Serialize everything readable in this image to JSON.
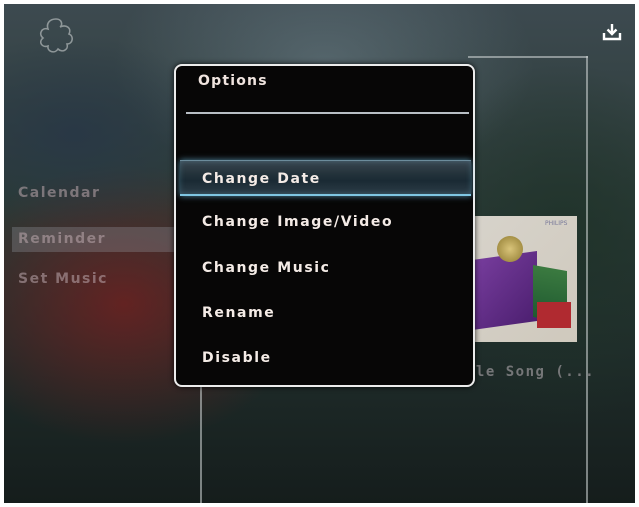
{
  "dialog": {
    "title": "Options",
    "items": [
      {
        "label": "Change Date",
        "selected": true
      },
      {
        "label": "Change Image/Video",
        "selected": false
      },
      {
        "label": "Change Music",
        "selected": false
      },
      {
        "label": "Rename",
        "selected": false
      },
      {
        "label": "Disable",
        "selected": false
      }
    ]
  },
  "sidebar": {
    "items": [
      {
        "label": "Calendar"
      },
      {
        "label": "Reminder",
        "highlighted": true
      },
      {
        "label": "Set Music"
      }
    ]
  },
  "thumbnail": {
    "brand": "PHILIPS",
    "label": "ple Song (..."
  },
  "icons": {
    "top_left": "flower-icon",
    "top_right": "download-icon"
  },
  "colors": {
    "selection_glow": "#7fc6e2",
    "dialog_background": "#070606",
    "dialog_border": "#ececec"
  }
}
